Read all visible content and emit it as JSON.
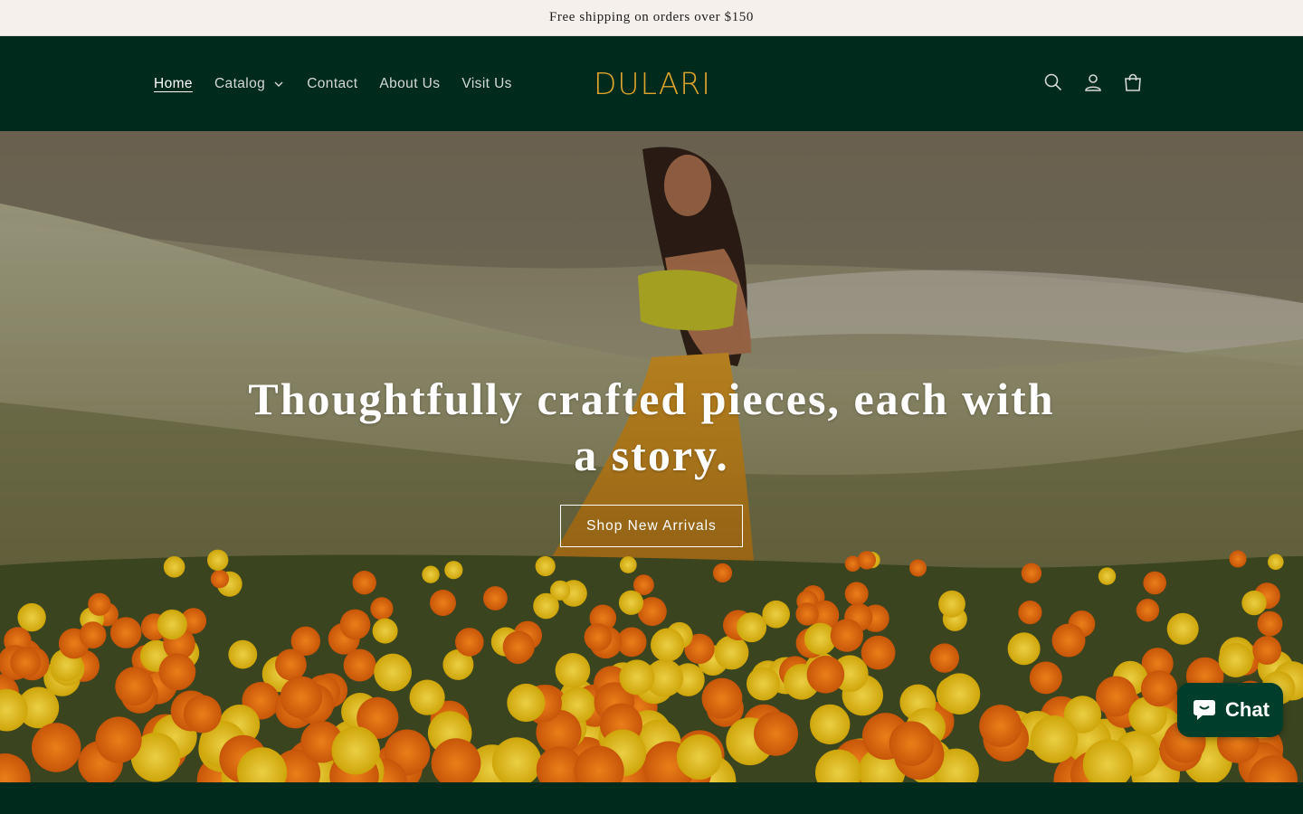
{
  "announcement": {
    "text": "Free shipping on orders over $150"
  },
  "header": {
    "nav": [
      {
        "label": "Home",
        "active": true
      },
      {
        "label": "Catalog",
        "has_dropdown": true
      },
      {
        "label": "Contact"
      },
      {
        "label": "About Us"
      },
      {
        "label": "Visit Us"
      }
    ],
    "logo_text": "DULARI",
    "icons": [
      "search-icon",
      "account-icon",
      "cart-icon"
    ]
  },
  "hero": {
    "heading": "Thoughtfully crafted pieces, each with a story.",
    "button_label": "Shop New Arrivals"
  },
  "chat": {
    "label": "Chat"
  },
  "colors": {
    "header_bg": "#002a1c",
    "announcement_bg": "#f6f0ec",
    "logo": "#e0a52d",
    "nav_text": "#d5d9d6",
    "chat_bg": "#003d2b"
  }
}
